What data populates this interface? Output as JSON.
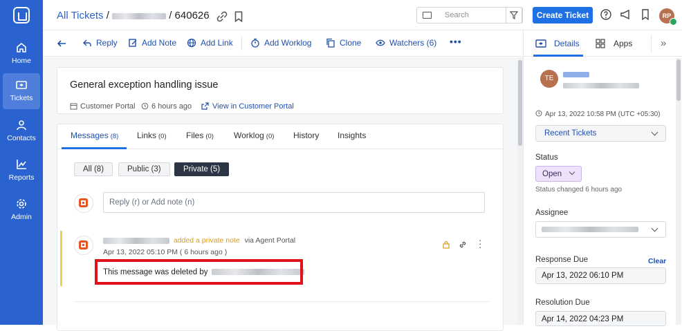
{
  "nav": [
    {
      "label": "Home",
      "icon": "home-icon"
    },
    {
      "label": "Tickets",
      "icon": "ticket-icon"
    },
    {
      "label": "Contacts",
      "icon": "person-icon"
    },
    {
      "label": "Reports",
      "icon": "chart-icon"
    },
    {
      "label": "Admin",
      "icon": "gear-icon"
    }
  ],
  "header": {
    "crumb_root": "All Tickets",
    "sep": "/",
    "ticket_id": "640626",
    "search_placeholder": "Search",
    "create_label": "Create Ticket",
    "avatar_initials": "RP"
  },
  "toolbar": {
    "reply": "Reply",
    "add_note": "Add Note",
    "add_link": "Add Link",
    "add_worklog": "Add Worklog",
    "clone": "Clone",
    "watchers": "Watchers (6)"
  },
  "ticket": {
    "title": "General exception handling issue",
    "source": "Customer Portal",
    "age": "6 hours ago",
    "portal_link": "View in Customer Portal"
  },
  "tabs": [
    {
      "label": "Messages",
      "count": "(8)"
    },
    {
      "label": "Links",
      "count": "(0)"
    },
    {
      "label": "Files",
      "count": "(0)"
    },
    {
      "label": "Worklog",
      "count": "(0)"
    },
    {
      "label": "History",
      "count": ""
    },
    {
      "label": "Insights",
      "count": ""
    }
  ],
  "filters": {
    "all": "All (8)",
    "public": "Public (3)",
    "private": "Private (5)"
  },
  "reply_placeholder": "Reply (r) or Add note (n)",
  "message": {
    "action": "added a private note",
    "via": "via Agent Portal",
    "time": "Apr 13, 2022 05:10 PM ( 6 hours ago )",
    "body": "This message was deleted by"
  },
  "right": {
    "tab_details": "Details",
    "tab_apps": "Apps",
    "contact_initials": "TE",
    "created": "Apr 13, 2022 10:58 PM (UTC +05:30)",
    "recent": "Recent Tickets",
    "status_label": "Status",
    "status_value": "Open",
    "status_changed": "Status changed 6 hours ago",
    "assignee_label": "Assignee",
    "response_label": "Response Due",
    "clear": "Clear",
    "response_value": "Apr 13, 2022 06:10 PM",
    "resolution_label": "Resolution Due",
    "resolution_value": "Apr 14, 2022 04:23 PM"
  },
  "colors": {
    "sidebar": "#2a62cf",
    "accent": "#1f6fe5",
    "highlight": "#e0131b",
    "private_note": "#d89a1c"
  }
}
